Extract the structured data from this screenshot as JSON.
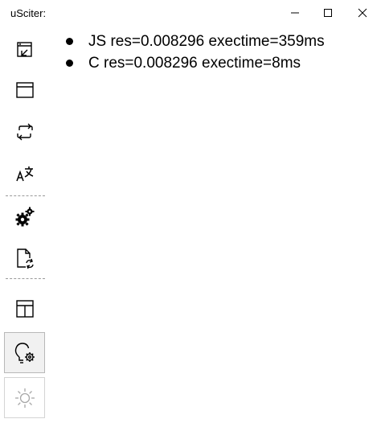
{
  "window": {
    "title": "uSciter:"
  },
  "sidebar": {
    "items": [
      {
        "icon": "window-arrow-icon",
        "state": "normal"
      },
      {
        "icon": "window-icon",
        "state": "normal"
      },
      {
        "icon": "refresh-icon",
        "state": "normal"
      },
      {
        "icon": "translate-icon",
        "state": "normal"
      },
      {
        "icon": "gears-icon",
        "state": "normal"
      },
      {
        "icon": "document-sync-icon",
        "state": "normal"
      },
      {
        "icon": "table-icon",
        "state": "normal"
      },
      {
        "icon": "lightbulb-gear-icon",
        "state": "active"
      },
      {
        "icon": "sun-icon",
        "state": "disabled"
      }
    ]
  },
  "results": [
    {
      "text": "JS res=0.008296 exectime=359ms"
    },
    {
      "text": "C res=0.008296 exectime=8ms"
    }
  ]
}
